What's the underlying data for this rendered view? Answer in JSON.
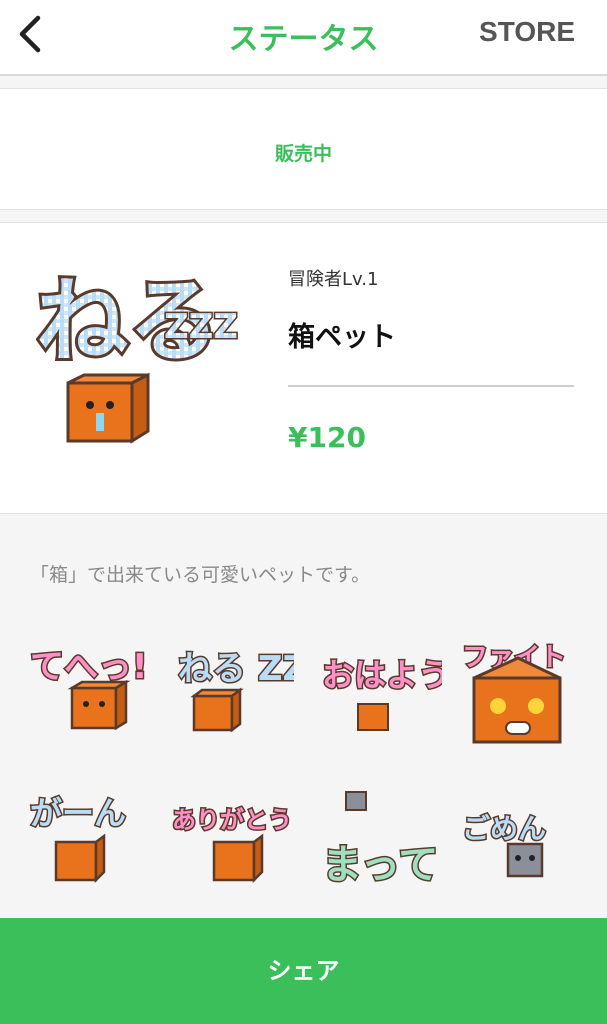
{
  "header": {
    "back_icon": "chevron-left-icon",
    "title": "ステータス",
    "store_label": "STORE"
  },
  "status": {
    "label": "販売中"
  },
  "product": {
    "author": "冒険者Lv.1",
    "name": "箱ペット",
    "price": "¥120",
    "main_sticker": {
      "text": "ねる",
      "sleep_text": "ZZZ"
    }
  },
  "description": "「箱」で出来ている可愛いペットです。",
  "stickers": [
    {
      "text": "てへっ!"
    },
    {
      "text": "ねる ZZZ"
    },
    {
      "text": "おはよう"
    },
    {
      "text": "ファイト"
    },
    {
      "text": "がーん"
    },
    {
      "text": "ありがとう"
    },
    {
      "text": "まって"
    },
    {
      "text": "ごめん"
    }
  ],
  "colors": {
    "accent": "#3bbf5a",
    "box_orange": "#e8731c",
    "pink": "#ff8fc8",
    "blue": "#a9d4f5",
    "mint": "#9fe0c0",
    "outline": "#5a3a2a"
  },
  "share_label": "シェア"
}
